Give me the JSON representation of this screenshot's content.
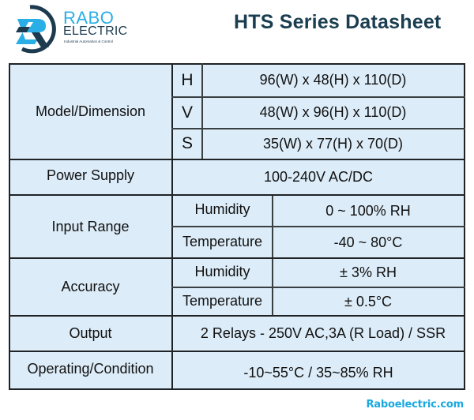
{
  "header": {
    "brand": {
      "name_top": "RABO",
      "name_bottom": "ELECTRIC",
      "tagline": "Industrial Automation & Control",
      "logo_icon": "rabo-electric-logo-icon",
      "colors": {
        "primary_blue": "#29aee6",
        "dark_navy": "#1c3b4e"
      }
    },
    "title": "HTS Series Datasheet"
  },
  "table": {
    "cell_background": "#dcecf8",
    "rows": [
      {
        "label": "Model/Dimension",
        "sub": [
          {
            "key": "H",
            "value": "96(W) x 48(H) x 110(D)"
          },
          {
            "key": "V",
            "value": "48(W) x 96(H) x 110(D)"
          },
          {
            "key": "S",
            "value": "35(W) x 77(H) x 70(D)"
          }
        ]
      },
      {
        "label": "Power Supply",
        "value": "100-240V AC/DC"
      },
      {
        "label": "Input Range",
        "sub": [
          {
            "key": "Humidity",
            "value": "0 ~ 100% RH"
          },
          {
            "key": "Temperature",
            "value": "-40 ~ 80°C"
          }
        ]
      },
      {
        "label": "Accuracy",
        "sub": [
          {
            "key": "Humidity",
            "value": "± 3% RH"
          },
          {
            "key": "Temperature",
            "value": "± 0.5°C"
          }
        ]
      },
      {
        "label": "Output",
        "value": "2 Relays - 250V AC,3A (R Load) / SSR"
      },
      {
        "label": "Operating/Condition",
        "value": "-10~55°C / 35~85% RH"
      }
    ]
  },
  "footer": {
    "website": "Raboelectric.com",
    "color": "#1aa9e0"
  }
}
